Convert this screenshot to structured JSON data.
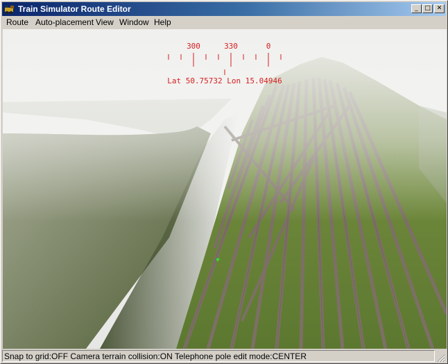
{
  "window": {
    "title": "Train Simulator Route Editor",
    "minimize_glyph": "_",
    "maximize_glyph": "□",
    "close_glyph": "✕"
  },
  "menu": {
    "items": [
      {
        "label": "Route"
      },
      {
        "label": "Auto-placement"
      },
      {
        "label": "View"
      },
      {
        "label": "Window"
      },
      {
        "label": "Help"
      }
    ]
  },
  "hud": {
    "compass_labels": [
      "300",
      "330",
      "0"
    ],
    "coordinates": "Lat 50.75732 Lon 15.04946",
    "color": "#d42020"
  },
  "status": {
    "text": "Snap to grid:OFF Camera terrain collision:ON Telephone pole edit mode:CENTER"
  },
  "colors": {
    "title_gradient_start": "#0a246a",
    "title_gradient_end": "#a6caf0",
    "chrome": "#d4d0c8",
    "terrain": "#6f8a3a",
    "track": "#7d6f66"
  }
}
